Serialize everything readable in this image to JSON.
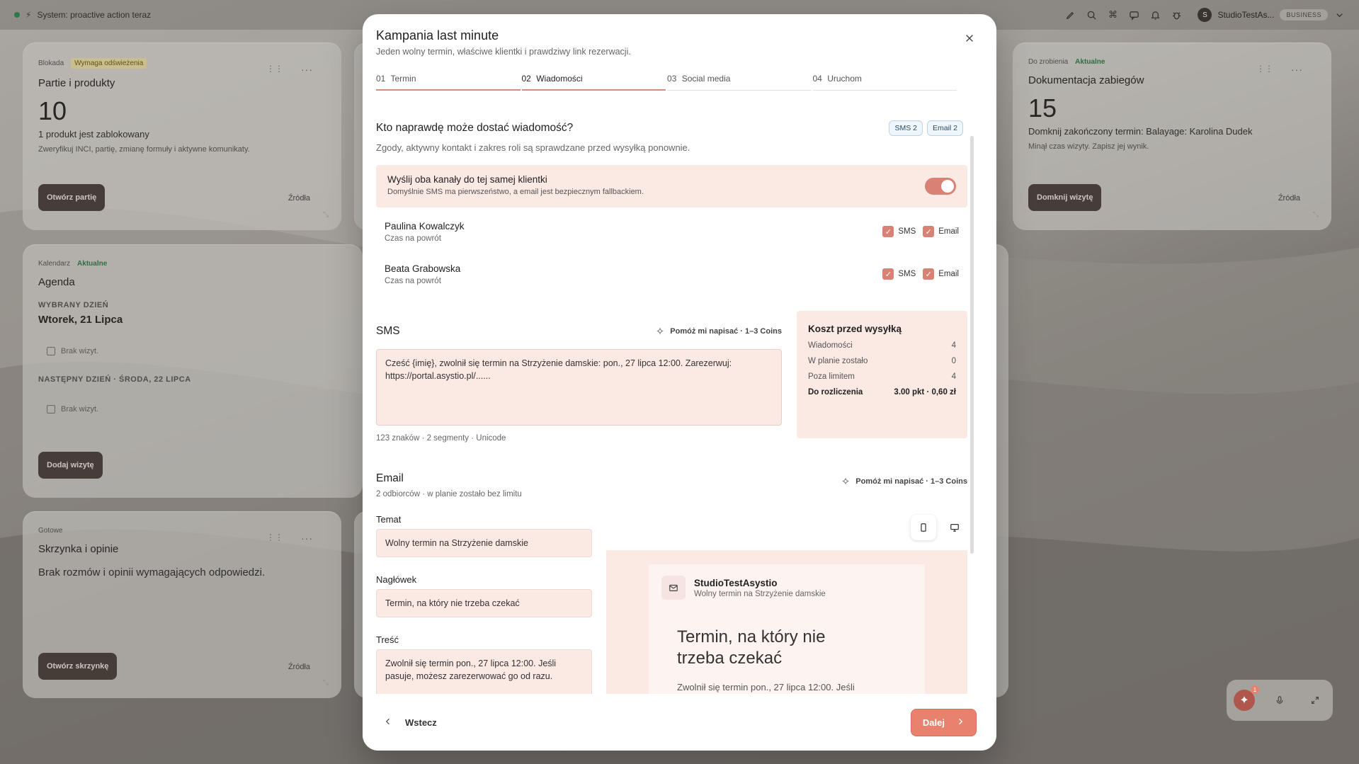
{
  "system": {
    "status_text": "System: proactive action teraz"
  },
  "org": {
    "name": "StudioTestAs...",
    "plan": "BUSINESS"
  },
  "cards": {
    "batches": {
      "category": "Blokada",
      "tag": "Wymaga odświeżenia",
      "title": "Partie i produkty",
      "count": "10",
      "line1": "1 produkt jest zablokowany",
      "line2": "Zweryfikuj INCI, partię, zmianę formuły i aktywne komunikaty.",
      "button": "Otwórz partię",
      "sources": "Źródła"
    },
    "docs": {
      "category": "Do zrobienia",
      "tag": "Aktualne",
      "title": "Dokumentacja zabiegów",
      "count": "15",
      "line1": "Domknij zakończony termin: Balayage: Karolina Dudek",
      "line2": "Minął czas wizyty. Zapisz jej wynik.",
      "button": "Domknij wizytę",
      "sources": "Źródła"
    },
    "agenda": {
      "category": "Kalendarz",
      "tag": "Aktualne",
      "title": "Agenda",
      "selected_label": "WYBRANY DZIEŃ",
      "selected_date": "Wtorek, 21 Lipca",
      "empty1": "Brak wizyt.",
      "next_label": "NASTĘPNY DZIEŃ · ŚRODA, 22 LIPCA",
      "empty2": "Brak wizyt.",
      "button": "Dodaj wizytę"
    },
    "inbox": {
      "category": "Gotowe",
      "title": "Skrzynka i opinie",
      "line1": "Brak rozmów i opinii wymagających odpowiedzi.",
      "button": "Otwórz skrzynkę",
      "sources": "Źródła"
    }
  },
  "modal": {
    "title": "Kampania last minute",
    "subtitle": "Jeden wolny termin, właściwe klientki i prawdziwy link rezerwacji.",
    "steps": [
      {
        "num": "01",
        "label": "Termin"
      },
      {
        "num": "02",
        "label": "Wiadomości"
      },
      {
        "num": "03",
        "label": "Social media"
      },
      {
        "num": "04",
        "label": "Uruchom"
      }
    ],
    "audience": {
      "title": "Kto naprawdę może dostać wiadomość?",
      "chip_sms": "SMS 2",
      "chip_email": "Email 2",
      "description": "Zgody, aktywny kontakt i zakres roli są sprawdzane przed wysyłką ponownie.",
      "toggle_title": "Wyślij oba kanały do tej samej klientki",
      "toggle_sub": "Domyślnie SMS ma pierwszeństwo, a email jest bezpiecznym fallbackiem.",
      "recipients": [
        {
          "name": "Paulina Kowalczyk",
          "status": "Czas na powrót",
          "sms": "SMS",
          "email": "Email"
        },
        {
          "name": "Beata Grabowska",
          "status": "Czas na powrót",
          "sms": "SMS",
          "email": "Email"
        }
      ]
    },
    "sms": {
      "title": "SMS",
      "help": "Pomóż mi napisać · 1–3 Coins",
      "text": "Cześć {imię}, zwolnił się termin na Strzyżenie damskie: pon., 27 lipca 12:00. Zarezerwuj: https://portal.asystio.pl/......",
      "counter": "123 znaków · 2 segmenty · Unicode"
    },
    "cost": {
      "title": "Koszt przed wysyłką",
      "rows": [
        {
          "label": "Wiadomości",
          "value": "4"
        },
        {
          "label": "W planie zostało",
          "value": "0"
        },
        {
          "label": "Poza limitem",
          "value": "4"
        }
      ],
      "total_label": "Do rozliczenia",
      "total_value": "3.00 pkt · 0,60 zł"
    },
    "email": {
      "title": "Email",
      "subtitle": "2 odbiorców · w planie zostało bez limitu",
      "help": "Pomóż mi napisać · 1–3 Coins",
      "subject_label": "Temat",
      "subject_value": "Wolny termin na Strzyżenie damskie",
      "header_label": "Nagłówek",
      "header_value": "Termin, na który nie trzeba czekać",
      "body_label": "Treść",
      "body_value": "Zwolnił się termin pon., 27 lipca 12:00. Jeśli pasuje, możesz zarezerwować go od razu.",
      "preview": {
        "brand": "StudioTestAsystio",
        "subject": "Wolny termin na Strzyżenie damskie",
        "headline": "Termin, na który nie trzeba czekać",
        "body": "Zwolnił się termin pon., 27 lipca 12:00. Jeśli"
      }
    },
    "footer": {
      "back": "Wstecz",
      "next": "Dalej"
    }
  },
  "voice": {
    "badge": "1"
  },
  "colors": {
    "accent": "#e9816f",
    "soft": "#fbe9e4",
    "dark_button": "#4a3f3a"
  }
}
